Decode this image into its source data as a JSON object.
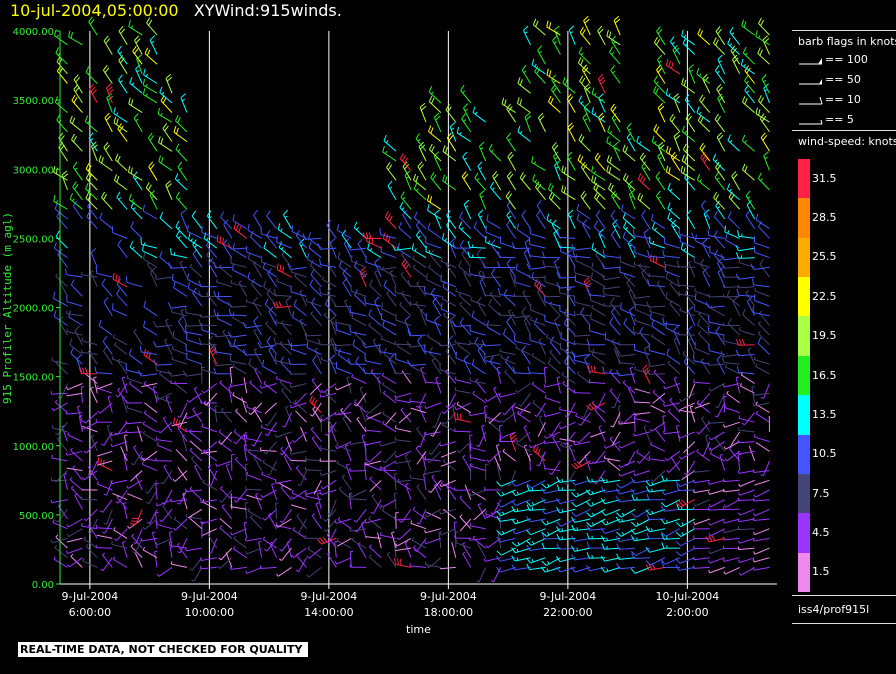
{
  "title": {
    "date": "10-jul-2004,05:00:00",
    "name": "XYWind:915winds."
  },
  "footer_note": "REAL-TIME DATA, NOT CHECKED FOR QUALITY",
  "legend": {
    "barb_title": "barb flags in knots",
    "barbs": [
      "== 100",
      "== 50",
      "== 10",
      "== 5"
    ],
    "speed_title": "wind-speed: knots",
    "speed_levels": [
      "31.5",
      "28.5",
      "25.5",
      "22.5",
      "19.5",
      "16.5",
      "13.5",
      "10.5",
      "7.5",
      "4.5",
      "1.5"
    ],
    "speed_colors": [
      "#ff2244",
      "#ff8800",
      "#ffaa00",
      "#ffff00",
      "#aaff44",
      "#22ee22",
      "#00ffff",
      "#4455ff",
      "#444477",
      "#9933ff",
      "#ee88ee"
    ],
    "station": "iss4/prof915l"
  },
  "chart_data": {
    "type": "wind-barb",
    "xlabel": "time",
    "ylabel": "915 Profiler Altitude (m agl)",
    "ylim": [
      0,
      4000
    ],
    "y_ticks": [
      "0.00",
      "500.00",
      "1000.00",
      "1500.00",
      "2000.00",
      "2500.00",
      "3000.00",
      "3500.00",
      "4000.00"
    ],
    "x_ticks": [
      {
        "date": "9-Jul-2004",
        "time": "6:00:00"
      },
      {
        "date": "9-Jul-2004",
        "time": "10:00:00"
      },
      {
        "date": "9-Jul-2004",
        "time": "14:00:00"
      },
      {
        "date": "9-Jul-2004",
        "time": "18:00:00"
      },
      {
        "date": "9-Jul-2004",
        "time": "22:00:00"
      },
      {
        "date": "10-Jul-2004",
        "time": "2:00:00"
      }
    ],
    "x_start_hours": 5,
    "x_end_hours": 29,
    "grid": "vertical lines at x ticks",
    "time_step_hours": 0.5,
    "height_step_m": 70
  }
}
